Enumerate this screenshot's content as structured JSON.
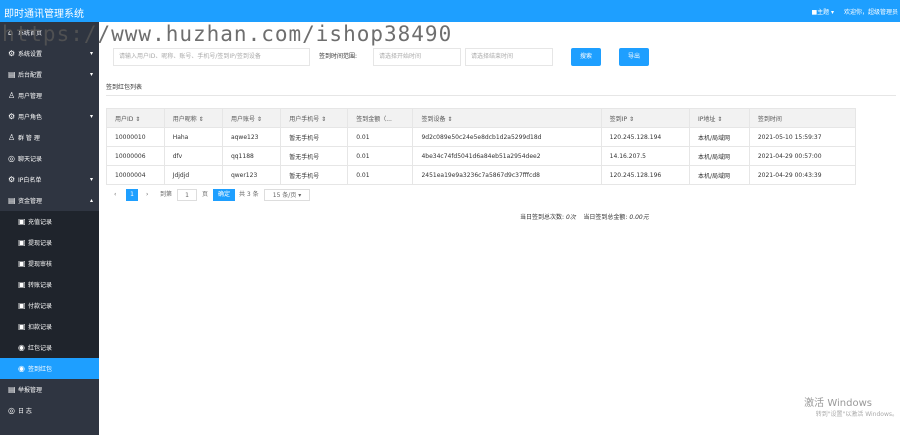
{
  "app_title": "即时通讯管理系统",
  "topbar": {
    "theme_label": "■主题 ▾",
    "welcome": "欢迎你，超级管理员"
  },
  "watermark": "https://www.huzhan.com/ishop38490",
  "sidebar": [
    {
      "icon": "⌂",
      "label": "系统首页",
      "chev": ""
    },
    {
      "icon": "⚙",
      "label": "系统设置",
      "chev": "▾"
    },
    {
      "icon": "▤",
      "label": "后台配置",
      "chev": "▾"
    },
    {
      "icon": "♙",
      "label": "用户管理",
      "chev": ""
    },
    {
      "icon": "⚙",
      "label": "用户角色",
      "chev": "▾"
    },
    {
      "icon": "♙",
      "label": "群 管 理",
      "chev": ""
    },
    {
      "icon": "◎",
      "label": "聊天记录",
      "chev": ""
    },
    {
      "icon": "⚙",
      "label": "IP白名单",
      "chev": "▾"
    },
    {
      "icon": "▤",
      "label": "资金管理",
      "chev": "▴"
    }
  ],
  "sidebar_sub": [
    {
      "icon": "▣",
      "label": "充值记录"
    },
    {
      "icon": "▣",
      "label": "提现记录"
    },
    {
      "icon": "▣",
      "label": "提现审核"
    },
    {
      "icon": "▣",
      "label": "转账记录"
    },
    {
      "icon": "▣",
      "label": "付款记录"
    },
    {
      "icon": "▣",
      "label": "扣款记录"
    },
    {
      "icon": "◉",
      "label": "红包记录"
    },
    {
      "icon": "◉",
      "label": "签到红包"
    }
  ],
  "sidebar_after": [
    {
      "icon": "▤",
      "label": "举报管理"
    },
    {
      "icon": "◎",
      "label": "日 志"
    }
  ],
  "search": {
    "placeholder_user": "请输入用户ID、昵称、账号、手机号/签到IP/签到设备",
    "time_label": "签到时间范围:",
    "placeholder_start": "请选择开始时间",
    "placeholder_end": "请选择结束时间",
    "search_btn": "搜索",
    "export_btn": "导出"
  },
  "section_title": "签到红包列表",
  "table": {
    "headers": [
      "用户ID ⇕",
      "用户昵称 ⇕",
      "用户账号 ⇕",
      "用户手机号 ⇕",
      "签到金额（...",
      "签到设备 ⇕",
      "签到IP ⇕",
      "IP地址 ⇕",
      "签到时间"
    ],
    "rows": [
      [
        "10000010",
        "Haha",
        "aqwe123",
        "暂无手机号",
        "0.01",
        "9d2c089e50c24e5e8dcb1d2a5299d18d",
        "120.245.128.194",
        "本机/局域网",
        "2021-05-10 15:59:37"
      ],
      [
        "10000006",
        "dfv",
        "qq1188",
        "暂无手机号",
        "0.01",
        "4be34c74fd5041d6a84eb51a2954dee2",
        "14.16.207.5",
        "本机/局域网",
        "2021-04-29 00:57:00"
      ],
      [
        "10000004",
        "Jdjdjd",
        "qwer123",
        "暂无手机号",
        "0.01",
        "2451ea19e9a3236c7a5867d9c37fffcd8",
        "120.245.128.196",
        "本机/局域网",
        "2021-04-29 00:43:39"
      ]
    ]
  },
  "pager": {
    "prev": "‹",
    "current": "1",
    "next": "›",
    "goto_label": "到第",
    "page_input": "1",
    "page_unit": "页",
    "go_btn": "确定",
    "total": "共 3 条",
    "page_size": "15 条/页 ▾"
  },
  "summary": {
    "count_label": "当日签到总次数:",
    "count_value": "0次",
    "amount_label": "当日签到总金额:",
    "amount_value": "0.00元"
  },
  "windows": {
    "line1": "激活 Windows",
    "line2": "转到\"设置\"以激活 Windows。"
  }
}
